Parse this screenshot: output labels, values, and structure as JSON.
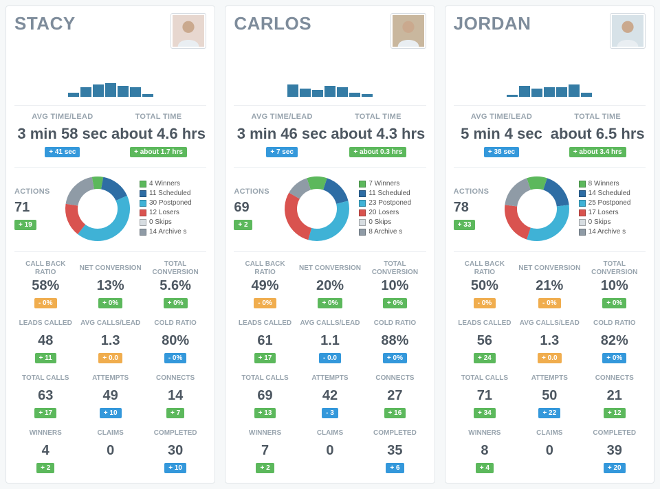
{
  "labels": {
    "avg_time_lead": "AVG TIME/LEAD",
    "total_time": "TOTAL TIME",
    "actions": "ACTIONS",
    "metrics": [
      "CALL BACK RATIO",
      "NET CONVERSION",
      "TOTAL CONVERSION",
      "LEADS CALLED",
      "AVG CALLS/LEAD",
      "COLD RATIO",
      "TOTAL CALLS",
      "ATTEMPTS",
      "CONNECTS",
      "WINNERS",
      "CLAIMS",
      "COMPLETED"
    ],
    "legend_names": [
      "Winners",
      "Scheduled",
      "Postponed",
      "Losers",
      "Skips",
      "Archive s"
    ]
  },
  "legend_colors": [
    "#5cb85c",
    "#2e6da4",
    "#3fb2d6",
    "#d9534f",
    "#d7dde1",
    "#8f9ba6"
  ],
  "users": [
    {
      "name": "STACY",
      "avatar_bg": "#e7d7cf",
      "spark": [
        6,
        14,
        18,
        20,
        16,
        14,
        4
      ],
      "avg_time": "3 min 58 sec",
      "avg_time_delta": {
        "text": "+ 41 sec",
        "cls": "b-blue"
      },
      "total_time": "about 4.6 hrs",
      "total_time_delta": {
        "text": "+ about 1.7 hrs",
        "cls": "b-green"
      },
      "actions": "71",
      "actions_delta": {
        "text": "+ 19",
        "cls": "b-green"
      },
      "legend_counts": [
        4,
        11,
        30,
        12,
        0,
        14
      ],
      "metrics": [
        {
          "val": "58%",
          "delta": {
            "text": "- 0%",
            "cls": "b-orange"
          }
        },
        {
          "val": "13%",
          "delta": {
            "text": "+ 0%",
            "cls": "b-green"
          }
        },
        {
          "val": "5.6%",
          "delta": {
            "text": "+ 0%",
            "cls": "b-green"
          }
        },
        {
          "val": "48",
          "delta": {
            "text": "+ 11",
            "cls": "b-green"
          }
        },
        {
          "val": "1.3",
          "delta": {
            "text": "+ 0.0",
            "cls": "b-orange"
          }
        },
        {
          "val": "80%",
          "delta": {
            "text": "- 0%",
            "cls": "b-blue"
          }
        },
        {
          "val": "63",
          "delta": {
            "text": "+ 17",
            "cls": "b-green"
          }
        },
        {
          "val": "49",
          "delta": {
            "text": "+ 10",
            "cls": "b-blue"
          }
        },
        {
          "val": "14",
          "delta": {
            "text": "+ 7",
            "cls": "b-green"
          }
        },
        {
          "val": "4",
          "delta": {
            "text": "+ 2",
            "cls": "b-green"
          }
        },
        {
          "val": "0",
          "delta": null
        },
        {
          "val": "30",
          "delta": {
            "text": "+ 10",
            "cls": "b-blue"
          }
        }
      ]
    },
    {
      "name": "CARLOS",
      "avatar_bg": "#c9b79e",
      "spark": [
        18,
        12,
        10,
        16,
        14,
        6,
        4
      ],
      "avg_time": "3 min 46 sec",
      "avg_time_delta": {
        "text": "+ 7 sec",
        "cls": "b-blue"
      },
      "total_time": "about 4.3 hrs",
      "total_time_delta": {
        "text": "+ about 0.3 hrs",
        "cls": "b-green"
      },
      "actions": "69",
      "actions_delta": {
        "text": "+ 2",
        "cls": "b-green"
      },
      "legend_counts": [
        7,
        11,
        23,
        20,
        0,
        8
      ],
      "metrics": [
        {
          "val": "49%",
          "delta": {
            "text": "- 0%",
            "cls": "b-orange"
          }
        },
        {
          "val": "20%",
          "delta": {
            "text": "+ 0%",
            "cls": "b-green"
          }
        },
        {
          "val": "10%",
          "delta": {
            "text": "+ 0%",
            "cls": "b-green"
          }
        },
        {
          "val": "61",
          "delta": {
            "text": "+ 17",
            "cls": "b-green"
          }
        },
        {
          "val": "1.1",
          "delta": {
            "text": "- 0.0",
            "cls": "b-blue"
          }
        },
        {
          "val": "88%",
          "delta": {
            "text": "+ 0%",
            "cls": "b-blue"
          }
        },
        {
          "val": "69",
          "delta": {
            "text": "+ 13",
            "cls": "b-green"
          }
        },
        {
          "val": "42",
          "delta": {
            "text": "- 3",
            "cls": "b-blue"
          }
        },
        {
          "val": "27",
          "delta": {
            "text": "+ 16",
            "cls": "b-green"
          }
        },
        {
          "val": "7",
          "delta": {
            "text": "+ 2",
            "cls": "b-green"
          }
        },
        {
          "val": "0",
          "delta": null
        },
        {
          "val": "35",
          "delta": {
            "text": "+ 6",
            "cls": "b-blue"
          }
        }
      ]
    },
    {
      "name": "JORDAN",
      "avatar_bg": "#d7e2e8",
      "spark": [
        3,
        16,
        12,
        14,
        14,
        18,
        6
      ],
      "avg_time": "5 min 4 sec",
      "avg_time_delta": {
        "text": "+ 38 sec",
        "cls": "b-blue"
      },
      "total_time": "about 6.5 hrs",
      "total_time_delta": {
        "text": "+ about 3.4 hrs",
        "cls": "b-green"
      },
      "actions": "78",
      "actions_delta": {
        "text": "+ 33",
        "cls": "b-green"
      },
      "legend_counts": [
        8,
        14,
        25,
        17,
        0,
        14
      ],
      "metrics": [
        {
          "val": "50%",
          "delta": {
            "text": "- 0%",
            "cls": "b-orange"
          }
        },
        {
          "val": "21%",
          "delta": {
            "text": "- 0%",
            "cls": "b-orange"
          }
        },
        {
          "val": "10%",
          "delta": {
            "text": "+ 0%",
            "cls": "b-green"
          }
        },
        {
          "val": "56",
          "delta": {
            "text": "+ 24",
            "cls": "b-green"
          }
        },
        {
          "val": "1.3",
          "delta": {
            "text": "+ 0.0",
            "cls": "b-orange"
          }
        },
        {
          "val": "82%",
          "delta": {
            "text": "+ 0%",
            "cls": "b-blue"
          }
        },
        {
          "val": "71",
          "delta": {
            "text": "+ 34",
            "cls": "b-green"
          }
        },
        {
          "val": "50",
          "delta": {
            "text": "+ 22",
            "cls": "b-blue"
          }
        },
        {
          "val": "21",
          "delta": {
            "text": "+ 12",
            "cls": "b-green"
          }
        },
        {
          "val": "8",
          "delta": {
            "text": "+ 4",
            "cls": "b-green"
          }
        },
        {
          "val": "0",
          "delta": null
        },
        {
          "val": "39",
          "delta": {
            "text": "+ 20",
            "cls": "b-blue"
          }
        }
      ]
    }
  ],
  "chart_data": [
    {
      "type": "pie",
      "title": "Stacy actions",
      "categories": [
        "Winners",
        "Scheduled",
        "Postponed",
        "Losers",
        "Skips",
        "Archive s"
      ],
      "values": [
        4,
        11,
        30,
        12,
        0,
        14
      ]
    },
    {
      "type": "pie",
      "title": "Carlos actions",
      "categories": [
        "Winners",
        "Scheduled",
        "Postponed",
        "Losers",
        "Skips",
        "Archive s"
      ],
      "values": [
        7,
        11,
        23,
        20,
        0,
        8
      ]
    },
    {
      "type": "pie",
      "title": "Jordan actions",
      "categories": [
        "Winners",
        "Scheduled",
        "Postponed",
        "Losers",
        "Skips",
        "Archive s"
      ],
      "values": [
        8,
        14,
        25,
        17,
        0,
        14
      ]
    },
    {
      "type": "bar",
      "title": "Stacy sparkline",
      "categories": [
        "1",
        "2",
        "3",
        "4",
        "5",
        "6",
        "7"
      ],
      "values": [
        6,
        14,
        18,
        20,
        16,
        14,
        4
      ]
    },
    {
      "type": "bar",
      "title": "Carlos sparkline",
      "categories": [
        "1",
        "2",
        "3",
        "4",
        "5",
        "6",
        "7"
      ],
      "values": [
        18,
        12,
        10,
        16,
        14,
        6,
        4
      ]
    },
    {
      "type": "bar",
      "title": "Jordan sparkline",
      "categories": [
        "1",
        "2",
        "3",
        "4",
        "5",
        "6",
        "7"
      ],
      "values": [
        3,
        16,
        12,
        14,
        14,
        18,
        6
      ]
    }
  ]
}
